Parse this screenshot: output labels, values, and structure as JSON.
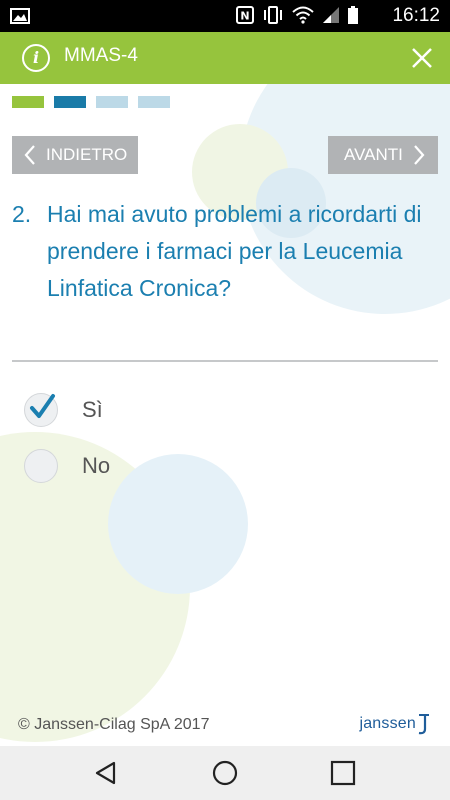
{
  "status_bar": {
    "time": "16:12",
    "icons": [
      "image-icon",
      "nfc-icon",
      "vibrate-icon",
      "wifi-icon",
      "signal-icon",
      "battery-icon"
    ]
  },
  "app_bar": {
    "title": "MMAS-4",
    "info_icon_glyph": "i",
    "icons": [
      "info-icon",
      "close-icon"
    ]
  },
  "progress": {
    "current_step": 2,
    "total_steps": 4,
    "segment_colors": [
      "#96c43d",
      "#1a7ba8",
      "#bcd9e7",
      "#bcd9e7"
    ]
  },
  "navigation": {
    "back_label": "INDIETRO",
    "next_label": "AVANTI"
  },
  "question": {
    "number": "2.",
    "text": "Hai mai avuto problemi a ricordarti di prendere i farmaci per la Leucemia Linfatica Cronica?"
  },
  "options": [
    {
      "label": "Sì",
      "checked": true
    },
    {
      "label": "No",
      "checked": false
    }
  ],
  "footer": {
    "copyright": "© Janssen-Cilag SpA 2017",
    "brand": "janssen"
  },
  "colors": {
    "accent_green": "#96c43d",
    "question_blue": "#1b7fb0",
    "check_blue": "#1b7fb0",
    "button_gray": "#b1b3b5"
  },
  "system_nav": [
    "back-icon",
    "home-icon",
    "recents-icon"
  ]
}
